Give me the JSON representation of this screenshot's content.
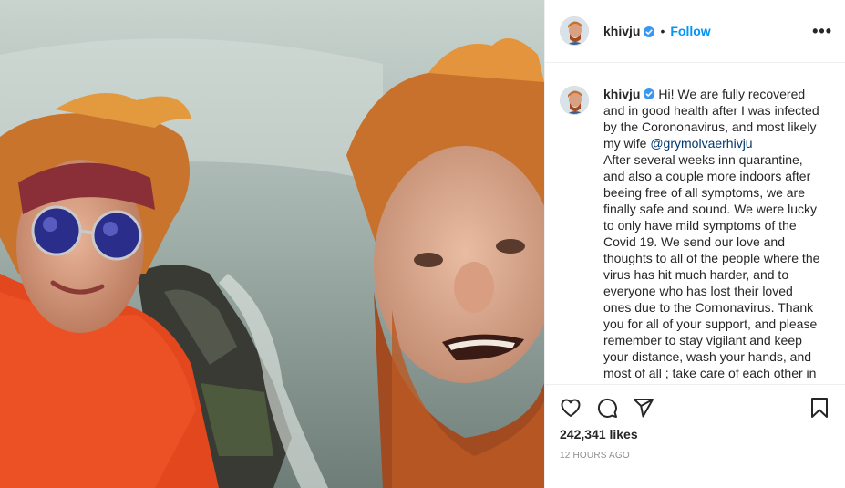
{
  "post": {
    "author": "khivju",
    "follow_label": "Follow",
    "separator": "•",
    "more_label": "•••",
    "caption_text": "Hi! We are fully recovered and in good health after I was infected by the Corononavirus, and most likely my wife ",
    "mention": "@grymolvaerhivju",
    "caption_rest": "After several weeks inn quarantine, and also a couple more indoors after beeing free of all symptoms, we are finally safe and sound. We were lucky to only have mild symptoms of the Covid 19. We send our love and thoughts to all of the people where the virus has hit much harder, and to everyone who has lost their loved ones due to the Cornonavirus. Thank you for all of your support, and please remember to stay vigilant and keep your distance, wash your hands, and most of all ; take care of each other in",
    "likes": "242,341 likes",
    "timestamp": "12 HOURS AGO"
  },
  "icons": {
    "like": "heart-icon",
    "comment": "comment-icon",
    "share": "share-icon",
    "save": "bookmark-icon",
    "verified": "verified-badge-icon"
  },
  "colors": {
    "follow": "#0095f6",
    "verified": "#3897f0",
    "text": "#262626",
    "muted": "#8e8e8e"
  }
}
